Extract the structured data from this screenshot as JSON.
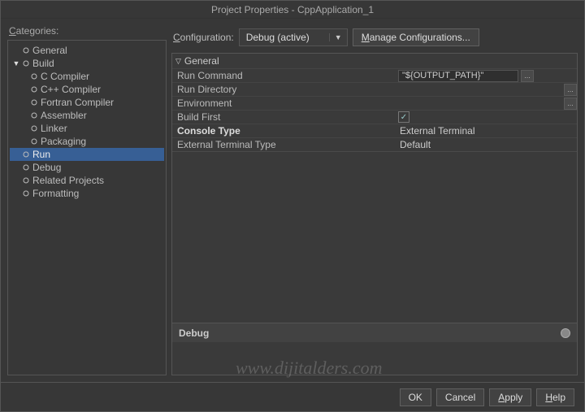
{
  "title": "Project Properties - CppApplication_1",
  "categories_label": "Categories:",
  "tree": {
    "general": "General",
    "build": "Build",
    "c_compiler": "C Compiler",
    "cpp_compiler": "C++ Compiler",
    "fortran_compiler": "Fortran Compiler",
    "assembler": "Assembler",
    "linker": "Linker",
    "packaging": "Packaging",
    "run": "Run",
    "debug": "Debug",
    "related_projects": "Related Projects",
    "formatting": "Formatting"
  },
  "config": {
    "label": "Configuration:",
    "value": "Debug (active)",
    "manage": "Manage Configurations..."
  },
  "props": {
    "group": "General",
    "run_command": {
      "label": "Run Command",
      "value": "\"${OUTPUT_PATH}\""
    },
    "run_directory": {
      "label": "Run Directory",
      "value": ""
    },
    "environment": {
      "label": "Environment",
      "value": ""
    },
    "build_first": {
      "label": "Build First",
      "checked": "✓"
    },
    "console_type": {
      "label": "Console Type",
      "value": "External Terminal"
    },
    "external_terminal": {
      "label": "External Terminal Type",
      "value": "Default"
    }
  },
  "debug_bar": "Debug",
  "footer": {
    "ok": "OK",
    "cancel": "Cancel",
    "apply": "Apply",
    "help": "Help"
  },
  "watermark": "www.dijitalders.com"
}
